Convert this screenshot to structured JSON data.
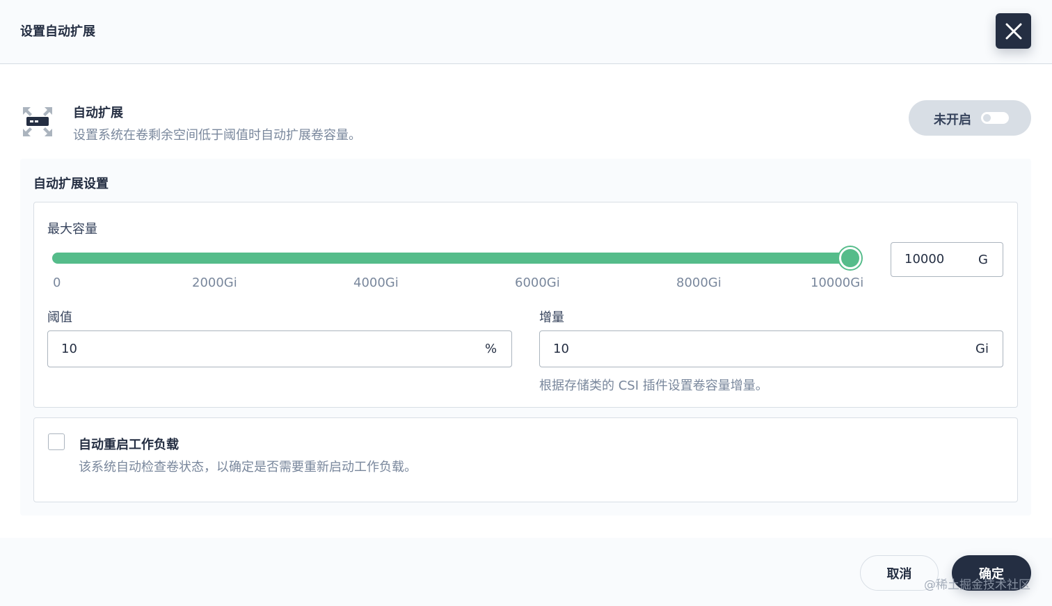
{
  "header": {
    "title": "设置自动扩展"
  },
  "feature": {
    "title": "自动扩展",
    "description": "设置系统在卷剩余空间低于阈值时自动扩展卷容量。",
    "toggle_label": "未开启",
    "enabled": false
  },
  "settings": {
    "title": "自动扩展设置",
    "max_capacity": {
      "label": "最大容量",
      "slider_min": 0,
      "slider_max": 10000,
      "slider_value": 10000,
      "ticks": [
        "0",
        "2000Gi",
        "4000Gi",
        "6000Gi",
        "8000Gi",
        "10000Gi"
      ],
      "input_value": "10000",
      "unit": "G"
    },
    "threshold": {
      "label": "阈值",
      "value": "10",
      "unit": "%"
    },
    "increment": {
      "label": "增量",
      "value": "10",
      "unit": "Gi",
      "hint": "根据存储类的 CSI 插件设置卷容量增量。"
    }
  },
  "restart": {
    "title": "自动重启工作负载",
    "description": "该系统自动检查卷状态，以确定是否需要重新启动工作负载。",
    "checked": false
  },
  "footer": {
    "cancel_label": "取消",
    "ok_label": "确定"
  },
  "watermark": "@稀土掘金技术社区",
  "colors": {
    "accent": "#55bc8a",
    "dark": "#242e42",
    "muted": "#79879c",
    "border": "#d8dee5"
  }
}
